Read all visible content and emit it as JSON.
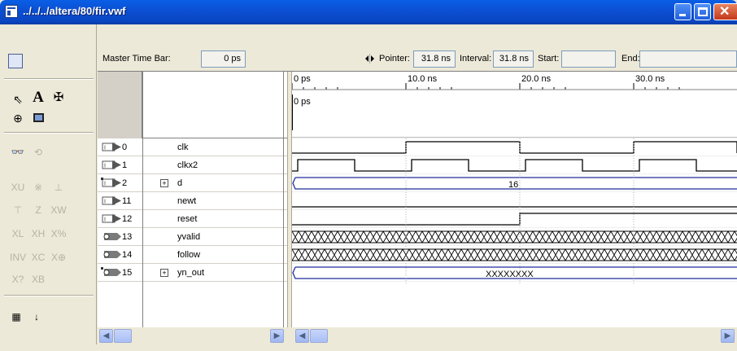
{
  "window": {
    "title": "../../../altera/80/fir.vwf"
  },
  "toolbar": {
    "tools": [
      "save-waveform-icon",
      "pointer-tool-icon",
      "text-tool-icon",
      "waveform-editing-tool-icon",
      "zoom-tool-icon",
      "full-screen-icon",
      "find-icon",
      "replace-icon",
      "uninitialized-icon",
      "forcing-unknown-icon",
      "forcing-low-icon",
      "forcing-high-icon",
      "high-impedance-icon",
      "weak-low-icon",
      "weak-high-icon",
      "invert-icon",
      "count-value-icon",
      "clock-value-icon",
      "arbitrary-value-icon",
      "random-value-icon",
      "snap-to-grid-icon",
      "sort-icon"
    ]
  },
  "info": {
    "master_time_bar_label": "Master Time Bar:",
    "master_time_bar_value": "0 ps",
    "pointer_label": "Pointer:",
    "pointer_value": "31.8 ns",
    "interval_label": "Interval:",
    "interval_value": "31.8 ns",
    "start_label": "Start:",
    "start_value": "",
    "end_label": "End:",
    "end_value": ""
  },
  "timeline": {
    "ticks": [
      "0 ps",
      "10.0 ns",
      "20.0 ns",
      "30.0 ns"
    ],
    "cursor_label": "0 ps"
  },
  "signals": [
    {
      "index": "0",
      "name": "clk",
      "type": "input",
      "group": false
    },
    {
      "index": "1",
      "name": "clkx2",
      "type": "input",
      "group": false
    },
    {
      "index": "2",
      "name": "d",
      "type": "input-bus",
      "group": true
    },
    {
      "index": "11",
      "name": "newt",
      "type": "input",
      "group": false
    },
    {
      "index": "12",
      "name": "reset",
      "type": "input",
      "group": false
    },
    {
      "index": "13",
      "name": "yvalid",
      "type": "output",
      "group": false
    },
    {
      "index": "14",
      "name": "follow",
      "type": "output",
      "group": false
    },
    {
      "index": "15",
      "name": "yn_out",
      "type": "output-bus",
      "group": true
    }
  ],
  "wave_labels": {
    "d_value": "16",
    "yn_out_value": "XXXXXXXX"
  },
  "colors": {
    "titlebar": "#0b50d4",
    "bus_wave": "#1f2f9c",
    "window_bg": "#ece9d8"
  }
}
